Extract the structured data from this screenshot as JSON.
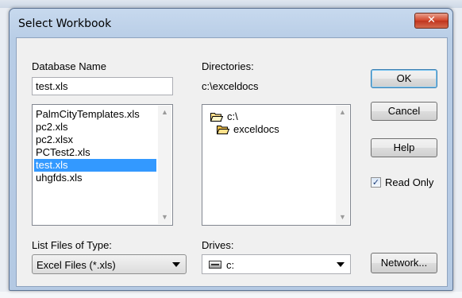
{
  "window": {
    "title": "Select Workbook",
    "close_glyph": "✕"
  },
  "database": {
    "label": "Database Name",
    "value": "test.xls",
    "files": [
      {
        "name": "PalmCityTemplates.xls",
        "selected": false
      },
      {
        "name": "pc2.xls",
        "selected": false
      },
      {
        "name": "pc2.xlsx",
        "selected": false
      },
      {
        "name": "PCTest2.xls",
        "selected": false
      },
      {
        "name": "test.xls",
        "selected": true
      },
      {
        "name": "uhgfds.xls",
        "selected": false
      }
    ]
  },
  "directories": {
    "label": "Directories:",
    "current_path": "c:\\exceldocs",
    "tree": [
      {
        "name": "c:\\",
        "icon": "open-folder-icon"
      },
      {
        "name": "exceldocs",
        "icon": "open-folder-icon"
      }
    ]
  },
  "file_type": {
    "label": "List Files of Type:",
    "selected": "Excel Files (*.xls)"
  },
  "drives": {
    "label": "Drives:",
    "selected": "c:",
    "icon": "drive-icon"
  },
  "buttons": {
    "ok": "OK",
    "cancel": "Cancel",
    "help": "Help",
    "network": "Network..."
  },
  "read_only": {
    "label": "Read Only",
    "checked": true,
    "check_glyph": "✓"
  },
  "colors": {
    "selection": "#3399ff",
    "title_gradient_top": "#c7d9ee",
    "close_button": "#c0341d"
  }
}
